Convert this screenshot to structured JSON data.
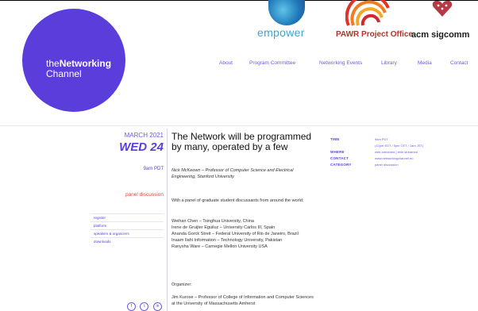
{
  "sponsors": {
    "empower": {
      "name": "empower",
      "icon": "globe-icon"
    },
    "pawr": {
      "name": "PAWR Project Office",
      "icon": "signal-arcs-icon"
    },
    "acm": {
      "name": "acm sigcomm",
      "icon": "heart-network-icon"
    }
  },
  "brand": {
    "prefix": "the",
    "bold": "Networking",
    "line2": "Channel"
  },
  "nav": {
    "items": [
      "About",
      "Program Committee",
      "Networking Events",
      "Library",
      "Media",
      "Contact"
    ]
  },
  "event": {
    "month": "MARCH 2021",
    "day": "WED 24",
    "time": "9am PDT",
    "type": "panel discussion",
    "title": "The Network will be programmed by many, operated by a few",
    "speaker": "Nick McKeown – Professor of Computer Science and Electrical Engineering, Stanford University",
    "intro": "With a panel of graduate student discussants from around the world:",
    "panelists": [
      "Weihan Chen – Tsinghua University, China",
      "Irene de Gruijter Eguiluz – University Carlos III, Spain",
      "Ananda Gorck Streit – Federal University of Rio de Janeiro, Brazil",
      "Inaam Ilahi Information – Technology University, Pakistan",
      "Ranysha Ware – Carnegie Mellon University USA"
    ],
    "organizer_label": "Organizer:",
    "organizer": "Jim Kurose – Professor of College of Information and Computer Sciences at the University of Massachusetts Amherst"
  },
  "sidebar_links": [
    "register",
    "platform",
    "speakers & organizers",
    "downloads"
  ],
  "social": [
    "facebook-icon",
    "twitter-icon",
    "linkedin-icon"
  ],
  "social_glyphs": [
    "f",
    "t",
    "in"
  ],
  "info": {
    "time_label": "TIME",
    "time_value_1": "9am PDT",
    "time_value_2": "(12pm EDT / 5pm CET / 1am JST)",
    "where_label": "WHERE",
    "where_value": "web-streamed | time streamed",
    "contact_label": "CONTACT",
    "contact_value": "www.networkingchannel.eu",
    "category_label": "CATEGORY",
    "category_value": "panel discussion"
  },
  "colors": {
    "accent": "#5b3ddc",
    "red": "#e04a3a",
    "link": "#6b5ce0"
  }
}
